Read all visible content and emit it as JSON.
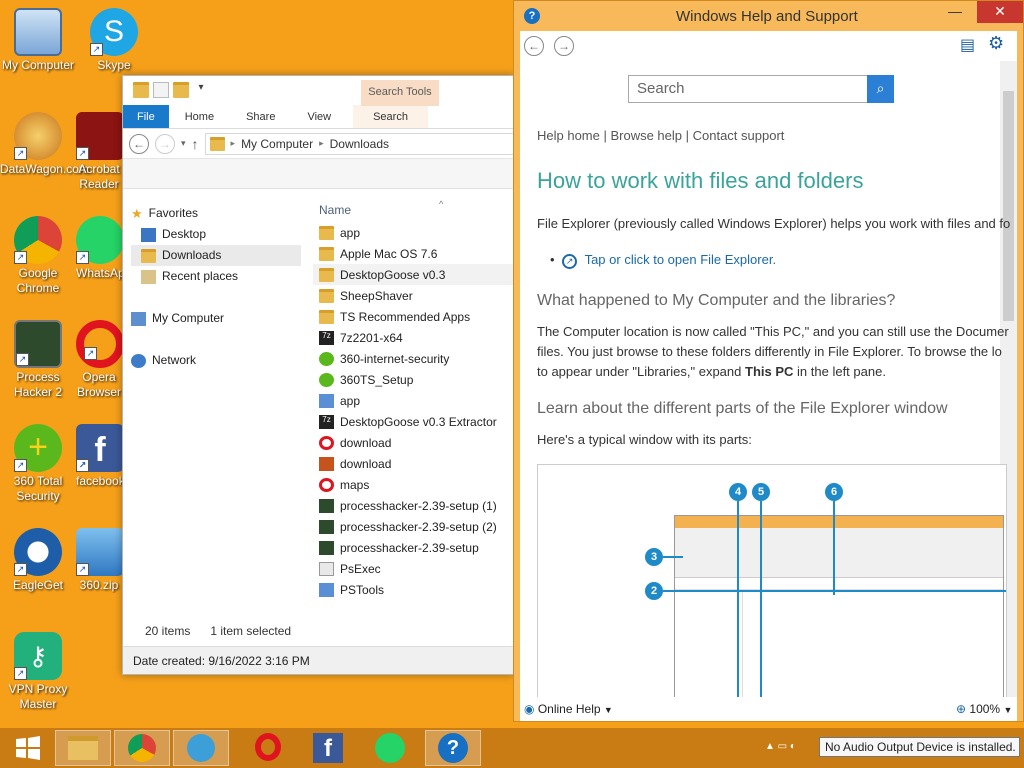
{
  "desktop": {
    "icons": [
      {
        "label": "My Computer"
      },
      {
        "label": "Skype"
      },
      {
        "label": "DataWagon.com"
      },
      {
        "label": "Acrobat Reader"
      },
      {
        "label": "Google Chrome"
      },
      {
        "label": "WhatsApp"
      },
      {
        "label": "Process Hacker 2"
      },
      {
        "label": "Opera Browser"
      },
      {
        "label": "360 Total Security"
      },
      {
        "label": "facebook"
      },
      {
        "label": "EagleGet"
      },
      {
        "label": "360.zip"
      },
      {
        "label": "VPN Proxy Master"
      }
    ]
  },
  "explorer": {
    "context_tab": "Search Tools",
    "tabs": [
      "File",
      "Home",
      "Share",
      "View",
      "Search"
    ],
    "breadcrumb": [
      "My Computer",
      "Downloads"
    ],
    "nav": {
      "favorites": "Favorites",
      "desktop": "Desktop",
      "downloads": "Downloads",
      "recent": "Recent places",
      "computer": "My Computer",
      "network": "Network"
    },
    "column_name": "Name",
    "files": [
      "app",
      "Apple Mac OS 7.6",
      "DesktopGoose v0.3",
      "SheepShaver",
      "TS Recommended Apps",
      "7z2201-x64",
      "360-internet-security",
      "360TS_Setup",
      "app",
      "DesktopGoose v0.3 Extractor",
      "download",
      "download",
      "maps",
      "processhacker-2.39-setup (1)",
      "processhacker-2.39-setup (2)",
      "processhacker-2.39-setup",
      "PsExec",
      "PSTools"
    ],
    "status_count": "20 items",
    "status_selected": "1 item selected",
    "details": "Date created: 9/16/2022 3:16 PM"
  },
  "help": {
    "title": "Windows Help and Support",
    "search_placeholder": "Search",
    "links": "Help home | Browse help | Contact support",
    "heading": "How to work with files and folders",
    "intro": "File Explorer (previously called Windows Explorer) helps you work with files and fo",
    "open_link": "Tap or click to open File Explorer.",
    "h2a": "What happened to My Computer and the libraries?",
    "p2_line1": "The Computer location is now called \"This PC,\" and you can still use the Documer",
    "p2_line2": "files. You just browse to these folders differently in File Explorer. To browse the lo",
    "p2_line3_pre": "to appear under \"Libraries,\" expand",
    "p2_line3_bold": "This PC",
    "p2_line3_post": "in the left pane.",
    "h2b": "Learn about the different parts of the File Explorer window",
    "p3": "Here's a typical window with its parts:",
    "diagram_callouts": [
      "4",
      "5",
      "6",
      "3",
      "2"
    ],
    "online_help": "Online Help",
    "zoom": "100%"
  },
  "taskbar": {
    "notification": "No Audio Output Device is installed."
  }
}
